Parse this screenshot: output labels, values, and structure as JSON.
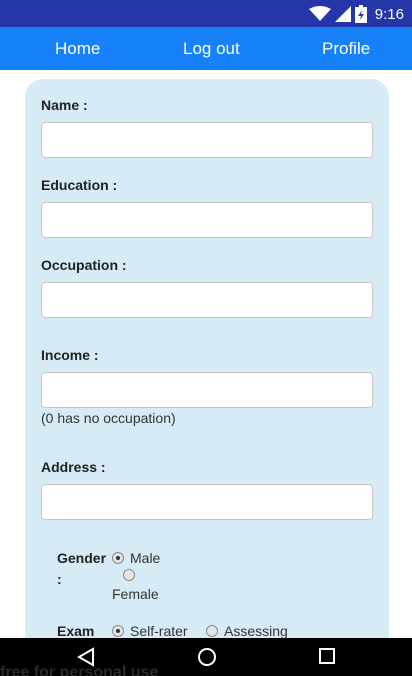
{
  "status_bar": {
    "time": "9:16"
  },
  "nav": {
    "home": "Home",
    "logout": "Log out",
    "profile": "Profile"
  },
  "form": {
    "name_label": "Name :",
    "education_label": "Education :",
    "occupation_label": "Occupation :",
    "income_label": "Income :",
    "income_hint": "(0 has no occupation)",
    "address_label": "Address :",
    "gender_label_line1": "Gender",
    "gender_label_line2": ":",
    "gender_options": [
      "Male",
      "Female"
    ],
    "gender_selected": "Male",
    "exam_label": "Exam",
    "exam_options": [
      "Self-rater",
      "Assessing"
    ],
    "exam_selected": "Self-rater"
  },
  "watermark": "free for personal use",
  "colors": {
    "status_bar": "#2536a8",
    "navbar": "#1681f8",
    "card": "#d6ebf6"
  },
  "icons": {
    "wifi": "wifi-icon",
    "signal": "cell-signal-icon",
    "battery": "battery-icon",
    "back": "back-triangle-icon",
    "home": "home-circle-icon",
    "recents": "recents-square-icon"
  }
}
